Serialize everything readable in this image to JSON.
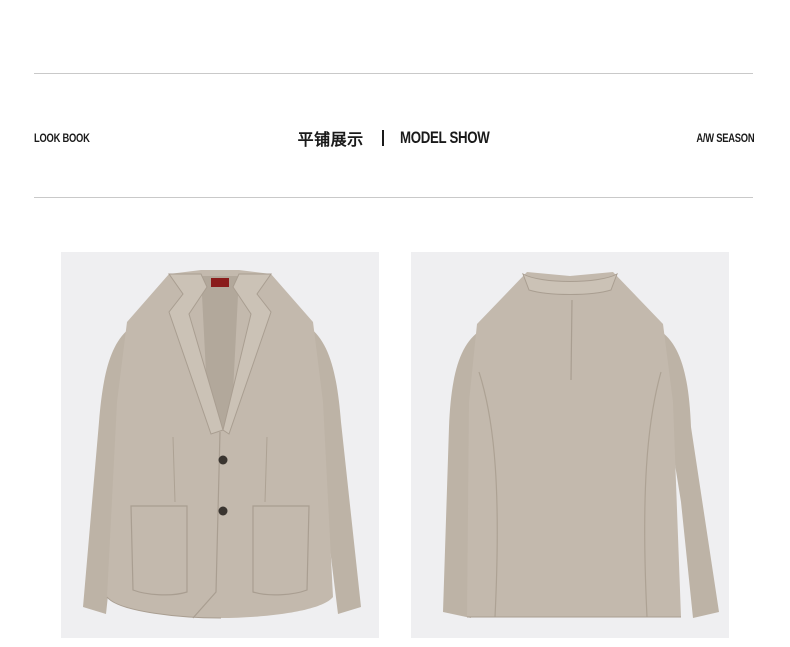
{
  "header": {
    "left_label": "LOOK BOOK",
    "title_cn": "平铺展示",
    "title_en": "MODEL SHOW",
    "right_label": "A/W SEASON"
  },
  "colors": {
    "background": "#ffffff",
    "photo_background": "#efeff1",
    "fabric": "#c3b9ad",
    "fabric_shadow": "#aea396",
    "text": "#1a1a1a",
    "rule": "#c9c9c9",
    "collar_label": "#8a1c1c"
  },
  "gallery": [
    {
      "name": "blazer-front",
      "icon": "blazer-front-photo"
    },
    {
      "name": "blazer-back",
      "icon": "blazer-back-photo"
    }
  ]
}
